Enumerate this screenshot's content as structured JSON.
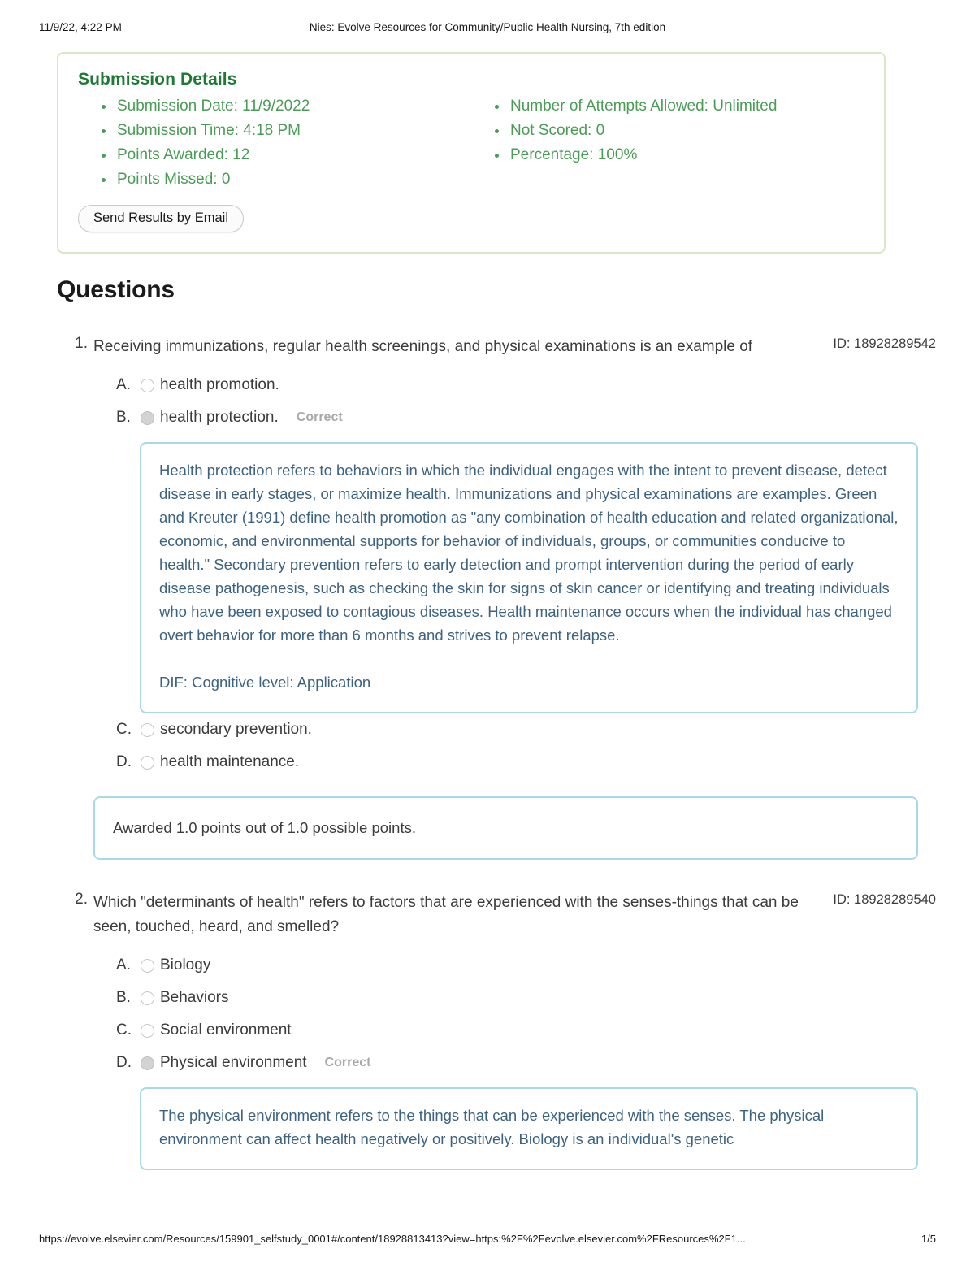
{
  "header": {
    "timestamp": "11/9/22, 4:22 PM",
    "title": "Nies: Evolve Resources for Community/Public Health Nursing, 7th edition"
  },
  "submission": {
    "title": "Submission Details",
    "left_items": [
      "Submission Date: 11/9/2022",
      "Submission Time: 4:18 PM",
      "Points Awarded: 12",
      "Points Missed: 0"
    ],
    "right_items": [
      "Number of Attempts Allowed: Unlimited",
      "Not Scored: 0",
      "Percentage: 100%"
    ],
    "send_button_label": "Send Results by Email",
    "title_color": "#1e7a32",
    "item_color": "#4a9d56",
    "border_color": "#d8e8c6"
  },
  "questions_heading": "Questions",
  "questions": [
    {
      "number": "1.",
      "id_label": "ID: 18928289542",
      "stem": "Receiving immunizations, regular health screenings, and physical examinations is an example of",
      "options": [
        {
          "letter": "A.",
          "text": "health promotion.",
          "selected": false,
          "tag": ""
        },
        {
          "letter": "B.",
          "text": "health protection.",
          "selected": true,
          "tag": "Correct"
        },
        {
          "letter": "C.",
          "text": "secondary prevention.",
          "selected": false,
          "tag": ""
        },
        {
          "letter": "D.",
          "text": "health maintenance.",
          "selected": false,
          "tag": ""
        }
      ],
      "feedback_after_option_index": 1,
      "feedback": [
        "Health protection refers to behaviors in which the individual engages with the intent to prevent disease, detect disease in early stages, or maximize health. Immunizations and physical examinations are examples. Green and Kreuter (1991) define health promotion as \"any combination of health education and related organizational, economic, and environmental supports for behavior of individuals, groups, or communities conducive to health.\" Secondary prevention refers to early detection and prompt intervention during the period of early disease pathogenesis, such as checking the skin for signs of skin cancer or identifying and treating individuals who have been exposed to contagious diseases. Health maintenance occurs when the individual has changed overt behavior for more than 6 months and strives to prevent relapse.",
        "DIF: Cognitive level: Application"
      ],
      "awarded": "Awarded 1.0 points out of 1.0 possible points."
    },
    {
      "number": "2.",
      "id_label": "ID: 18928289540",
      "stem": "Which \"determinants of health\" refers to factors that are experienced with the senses-things that can be seen, touched, heard, and smelled?",
      "options": [
        {
          "letter": "A.",
          "text": "Biology",
          "selected": false,
          "tag": ""
        },
        {
          "letter": "B.",
          "text": "Behaviors",
          "selected": false,
          "tag": ""
        },
        {
          "letter": "C.",
          "text": "Social environment",
          "selected": false,
          "tag": ""
        },
        {
          "letter": "D.",
          "text": "Physical environment",
          "selected": true,
          "tag": "Correct"
        }
      ],
      "feedback_after_option_index": 3,
      "feedback": [
        "The physical environment refers to the things that can be experienced with the senses. The physical environment can affect health negatively or positively. Biology is an individual's genetic"
      ],
      "awarded": ""
    }
  ],
  "footer": {
    "url": "https://evolve.elsevier.com/Resources/159901_selfstudy_0001#/content/18928813413?view=https:%2F%2Fevolve.elsevier.com%2FResources%2F1...",
    "page": "1/5"
  }
}
